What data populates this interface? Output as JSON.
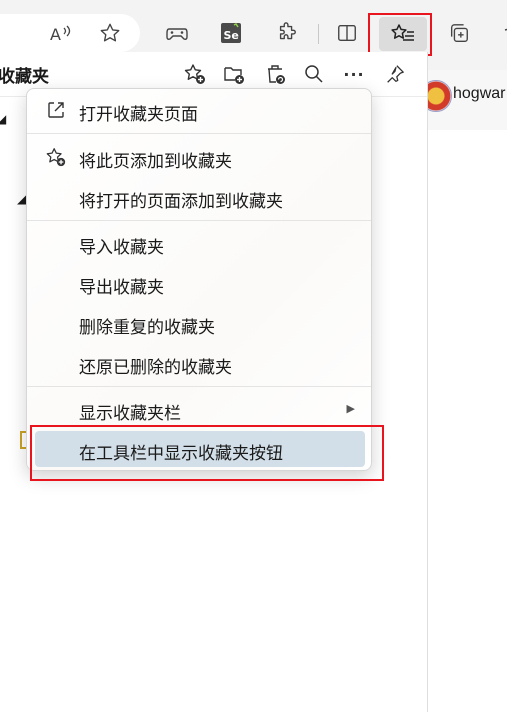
{
  "browser_toolbar": {
    "read_aloud_icon": "read-aloud-icon",
    "favorite_star_icon": "star-outline-icon",
    "extensions": [
      "gamepad-icon",
      "selenium-se-icon",
      "puzzle-icon"
    ],
    "split_screen_icon": "split-screen-icon",
    "favorites_icon": "favorites-list-icon",
    "collections_icon": "collections-icon",
    "selenium_label": "Se"
  },
  "favorites_panel": {
    "title": "收藏夹",
    "header_icons": [
      "add-favorite-icon",
      "add-folder-icon",
      "restore-deleted-icon",
      "search-icon",
      "more-icon",
      "pin-icon"
    ],
    "more_label": "···"
  },
  "profile": {
    "name": "hogwar"
  },
  "context_menu": {
    "items": [
      {
        "label": "打开收藏夹页面",
        "icon": "open-external-icon"
      },
      {
        "label": "将此页添加到收藏夹",
        "icon": "add-favorite-icon"
      },
      {
        "label": "将打开的页面添加到收藏夹",
        "icon": ""
      },
      {
        "label": "导入收藏夹",
        "icon": ""
      },
      {
        "label": "导出收藏夹",
        "icon": ""
      },
      {
        "label": "删除重复的收藏夹",
        "icon": ""
      },
      {
        "label": "还原已删除的收藏夹",
        "icon": ""
      },
      {
        "label": "显示收藏夹栏",
        "icon": "",
        "submenu": true
      },
      {
        "label": "在工具栏中显示收藏夹按钮",
        "icon": "",
        "hovered": true
      }
    ],
    "submenu_arrow": "▶"
  },
  "colors": {
    "highlight_red": "#e8141e",
    "hover_blue": "#d3dfe8",
    "toolbar_bg": "#f3f3f3"
  }
}
